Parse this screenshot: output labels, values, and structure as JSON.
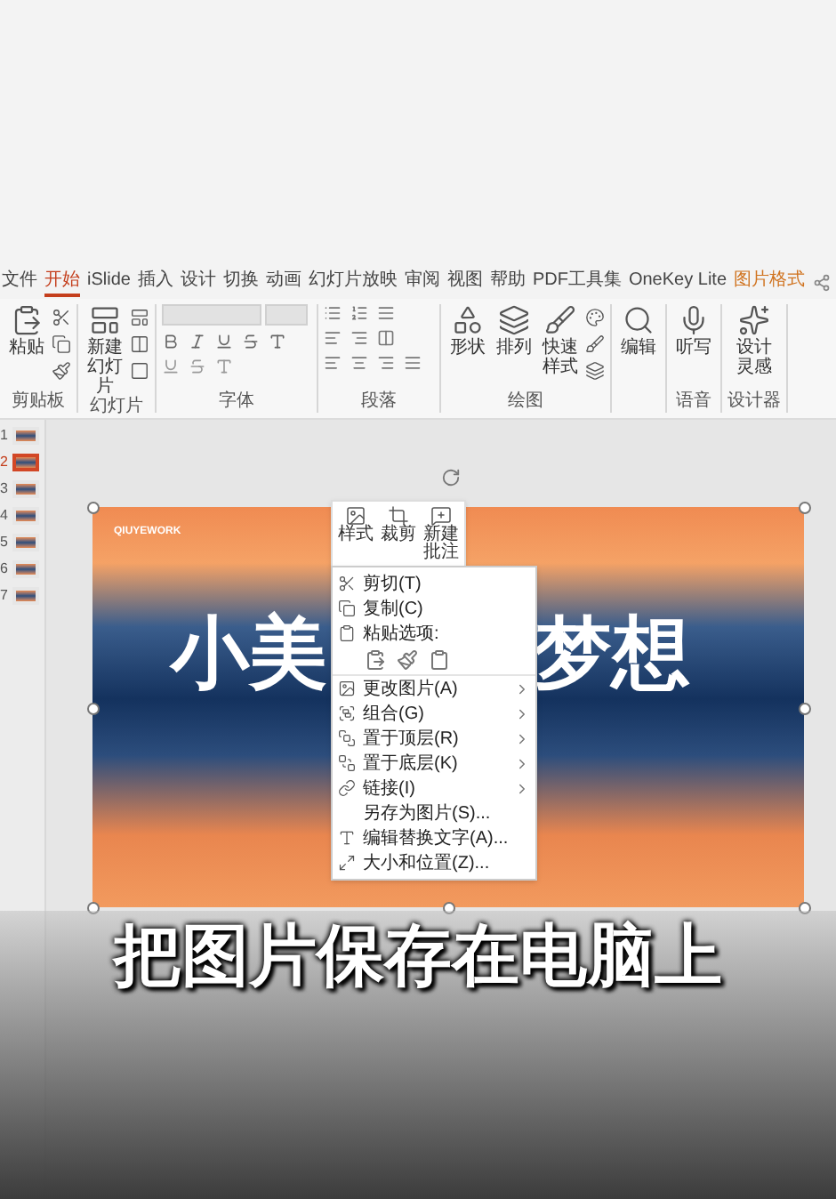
{
  "ribbon": {
    "tabs": [
      {
        "label": "文件",
        "selected": false,
        "contextual": false
      },
      {
        "label": "开始",
        "selected": true,
        "contextual": false
      },
      {
        "label": "iSlide",
        "selected": false,
        "contextual": false
      },
      {
        "label": "插入",
        "selected": false,
        "contextual": false
      },
      {
        "label": "设计",
        "selected": false,
        "contextual": false
      },
      {
        "label": "切换",
        "selected": false,
        "contextual": false
      },
      {
        "label": "动画",
        "selected": false,
        "contextual": false
      },
      {
        "label": "幻灯片放映",
        "selected": false,
        "contextual": false
      },
      {
        "label": "审阅",
        "selected": false,
        "contextual": false
      },
      {
        "label": "视图",
        "selected": false,
        "contextual": false
      },
      {
        "label": "帮助",
        "selected": false,
        "contextual": false
      },
      {
        "label": "PDF工具集",
        "selected": false,
        "contextual": false
      },
      {
        "label": "OneKey Lite",
        "selected": false,
        "contextual": false
      },
      {
        "label": "图片格式",
        "selected": false,
        "contextual": true
      }
    ],
    "groups": [
      {
        "kind": "clipboard",
        "label": "剪贴板",
        "buttons": [
          "粘贴"
        ]
      },
      {
        "kind": "slides",
        "label": "幻灯片",
        "buttons": [
          "新建幻灯片"
        ]
      },
      {
        "kind": "font",
        "label": "字体"
      },
      {
        "kind": "paragraph",
        "label": "段落"
      },
      {
        "kind": "drawing",
        "label": "绘图",
        "buttons": [
          "形状",
          "排列",
          "快速样式"
        ]
      },
      {
        "kind": "editing",
        "buttons": [
          "编辑"
        ]
      },
      {
        "kind": "voice",
        "label": "语音",
        "buttons": [
          "听写"
        ]
      },
      {
        "kind": "designer",
        "label": "设计器",
        "buttons": [
          "设计灵感"
        ]
      }
    ]
  },
  "thumbnails": [
    {
      "number": "1",
      "selected": false
    },
    {
      "number": "2",
      "selected": true
    },
    {
      "number": "3",
      "selected": false
    },
    {
      "number": "4",
      "selected": false
    },
    {
      "number": "5",
      "selected": false
    },
    {
      "number": "6",
      "selected": false
    },
    {
      "number": "7",
      "selected": false
    }
  ],
  "slide": {
    "brand": "QIUYEWORK",
    "title_parts": [
      "小美",
      "梦想"
    ]
  },
  "mini_toolbar": {
    "buttons": [
      "样式",
      "裁剪",
      "新建批注"
    ]
  },
  "context_menu": {
    "items": [
      {
        "kind": "command",
        "label": "剪切(T)",
        "submenu": false
      },
      {
        "kind": "command",
        "label": "复制(C)",
        "submenu": false
      },
      {
        "kind": "command",
        "label": "粘贴选项:",
        "submenu": false
      },
      {
        "kind": "paste_icons"
      },
      {
        "kind": "command",
        "label": "更改图片(A)",
        "submenu": true
      },
      {
        "kind": "command",
        "label": "组合(G)",
        "submenu": true
      },
      {
        "kind": "command",
        "label": "置于顶层(R)",
        "submenu": true
      },
      {
        "kind": "command",
        "label": "置于底层(K)",
        "submenu": true
      },
      {
        "kind": "command",
        "label": "链接(I)",
        "submenu": true
      },
      {
        "kind": "command",
        "label": "另存为图片(S)...",
        "submenu": false
      },
      {
        "kind": "command",
        "label": "编辑替换文字(A)...",
        "submenu": false
      },
      {
        "kind": "command",
        "label": "大小和位置(Z)...",
        "submenu": false
      }
    ]
  },
  "caption": "把图片保存在电脑上"
}
